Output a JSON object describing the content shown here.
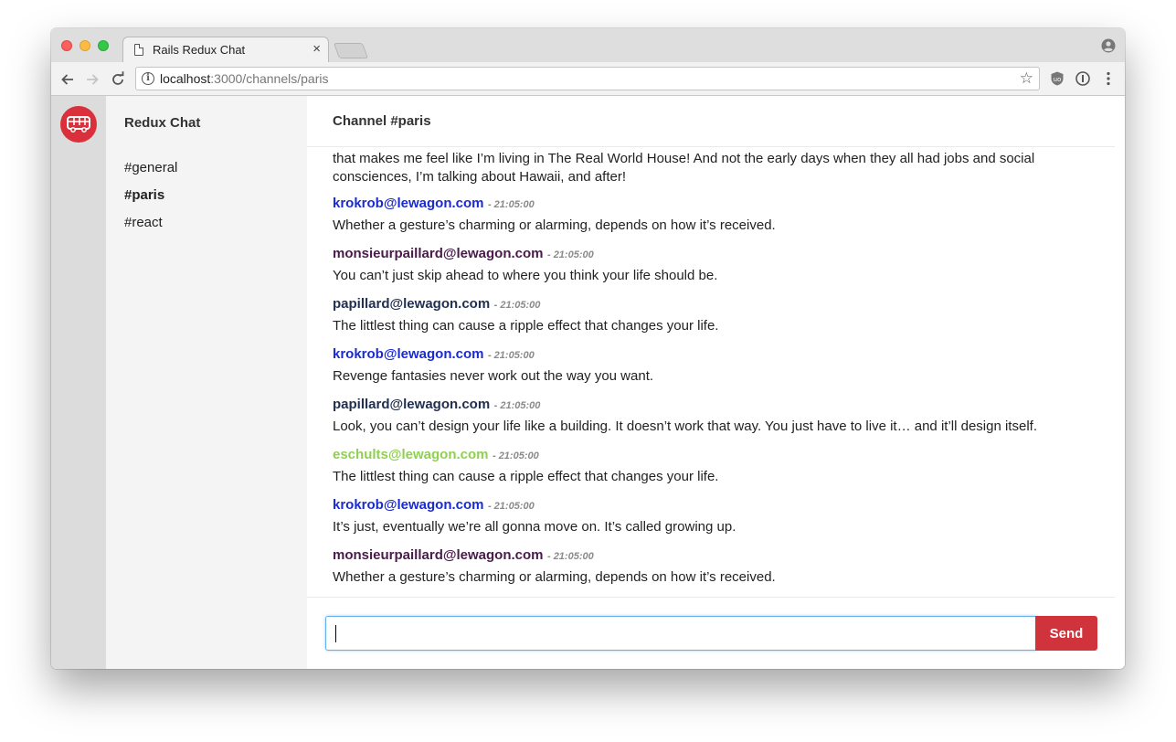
{
  "browser": {
    "tab_title": "Rails Redux Chat",
    "tab_close": "×",
    "url_host": "localhost",
    "url_rest": ":3000/channels/paris"
  },
  "sidebar": {
    "brand": "Redux Chat",
    "channels": [
      {
        "label": "#general",
        "active": false
      },
      {
        "label": "#paris",
        "active": true
      },
      {
        "label": "#react",
        "active": false
      }
    ]
  },
  "main": {
    "channel_title": "Channel #paris",
    "partial_message": "that makes me feel like I’m living in The Real World House! And not the early days when they all had jobs and social consciences, I’m talking about Hawaii, and after!",
    "messages": [
      {
        "author": "krokrob@lewagon.com",
        "color": "#1a2bd0",
        "time": "- 21:05:00",
        "text": "Whether a gesture’s charming or alarming, depends on how it’s received."
      },
      {
        "author": "monsieurpaillard@lewagon.com",
        "color": "#4a1a4a",
        "time": "- 21:05:00",
        "text": "You can’t just skip ahead to where you think your life should be."
      },
      {
        "author": "papillard@lewagon.com",
        "color": "#22304f",
        "time": "- 21:05:00",
        "text": "The littlest thing can cause a ripple effect that changes your life."
      },
      {
        "author": "krokrob@lewagon.com",
        "color": "#1a2bd0",
        "time": "- 21:05:00",
        "text": "Revenge fantasies never work out the way you want."
      },
      {
        "author": "papillard@lewagon.com",
        "color": "#22304f",
        "time": "- 21:05:00",
        "text": "Look, you can’t design your life like a building. It doesn’t work that way. You just have to live it… and it’ll design itself."
      },
      {
        "author": "eschults@lewagon.com",
        "color": "#8fd14f",
        "time": "- 21:05:00",
        "text": "The littlest thing can cause a ripple effect that changes your life."
      },
      {
        "author": "krokrob@lewagon.com",
        "color": "#1a2bd0",
        "time": "- 21:05:00",
        "text": "It’s just, eventually we’re all gonna move on. It’s called growing up."
      },
      {
        "author": "monsieurpaillard@lewagon.com",
        "color": "#4a1a4a",
        "time": "- 21:05:00",
        "text": "Whether a gesture’s charming or alarming, depends on how it’s received."
      }
    ],
    "composer": {
      "value": "",
      "send_label": "Send"
    }
  },
  "colors": {
    "accent": "#d0333b",
    "logo": "#d9303c"
  },
  "icons": [
    "page-icon",
    "close-icon",
    "profile-icon",
    "back-icon",
    "forward-icon",
    "reload-icon",
    "info-icon",
    "star-icon",
    "shield-extension-icon",
    "info-extension-icon",
    "menu-icon",
    "bus-logo-icon"
  ]
}
